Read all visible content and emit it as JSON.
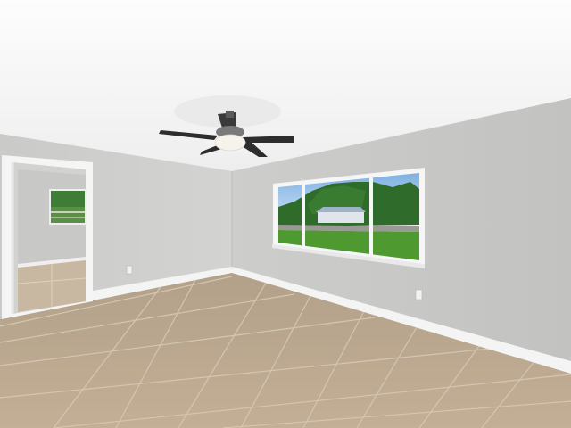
{
  "photo": {
    "subject": "empty-room",
    "palette": {
      "ceiling": "#fbfbfb",
      "left_wall": "#cfcfcd",
      "right_wall": "#c6c6c4",
      "baseboard": "#f4f4f4",
      "floor_tile": "#b9a58d",
      "grout": "#d7cab8",
      "window_frame": "#f7f7f7",
      "grass": "#4e9a31",
      "trees": "#2f6b2a",
      "sky": "#9cc4ea",
      "fan_blade": "#2d2d2d",
      "fan_light": "#f5f3ec"
    },
    "objects": [
      "ceiling-fan",
      "window",
      "doorway",
      "tile-floor",
      "electrical-outlet",
      "baseboard"
    ]
  }
}
